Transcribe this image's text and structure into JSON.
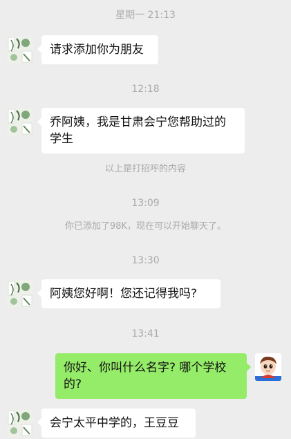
{
  "timestamps": {
    "t1": "星期一 21:13",
    "t2": "12:18",
    "t3": "13:09",
    "t4": "13:30",
    "t5": "13:41"
  },
  "system": {
    "greeting_note": "以上是打招呼的内容",
    "added_note": "你已添加了98K，现在可以开始聊天了。"
  },
  "messages": [
    {
      "from": "contact",
      "text": "请求添加你为朋友"
    },
    {
      "from": "contact",
      "text": "乔阿姨，我是甘肃会宁您帮助过的学生"
    },
    {
      "from": "contact",
      "text": "阿姨您好啊！您还记得我吗?"
    },
    {
      "from": "me",
      "text": "你好、你叫什么名字? 哪个学校的?"
    },
    {
      "from": "contact",
      "text": "会宁太平中学的，王豆豆"
    }
  ],
  "colors": {
    "background": "#ededed",
    "incoming_bubble": "#ffffff",
    "outgoing_bubble": "#95ec69",
    "meta_text": "#a9a9a9"
  },
  "icons": {
    "contact_avatar": "plant-photo-avatar",
    "my_avatar": "cartoon-boy-avatar"
  }
}
